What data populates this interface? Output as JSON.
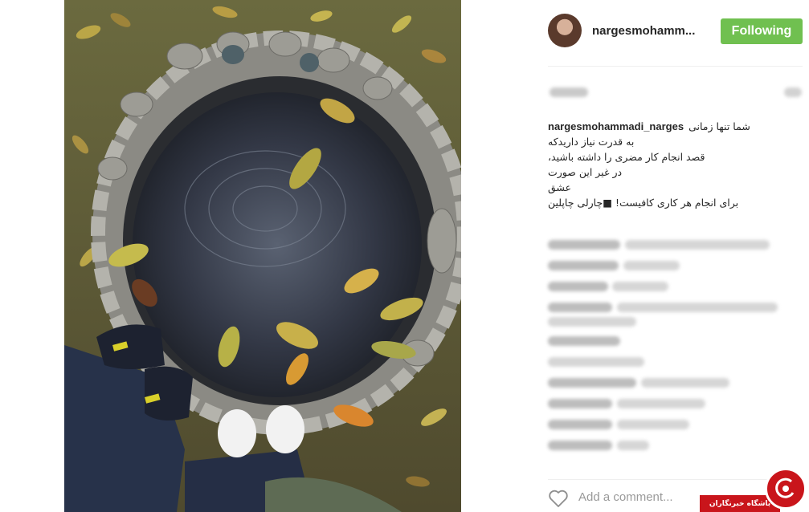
{
  "post": {
    "username_short": "nargesmohamm...",
    "follow_label": "Following",
    "caption": {
      "username": "nargesmohammadi_narges",
      "lines": [
        "شما تنها زمانی",
        "به قدرت نیاز داریدکه",
        "قصد انجام کار مضری را داشته باشید،",
        "در غیر این صورت",
        "عشق",
        "برای انجام هر کاری کافیست! ■چارلی چاپلین"
      ]
    },
    "add_comment_placeholder": "Add a comment...",
    "watermark_text": "باشگاه خبرنگاران"
  },
  "icons": [
    "heart-icon"
  ],
  "colors": {
    "following": "#70c050",
    "watermark": "#c9151b"
  }
}
